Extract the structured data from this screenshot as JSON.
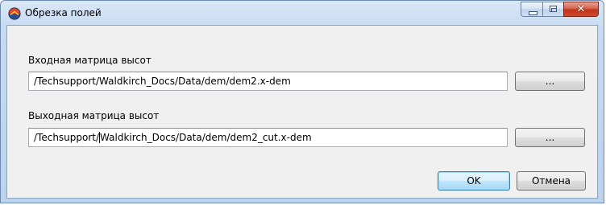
{
  "window": {
    "title": "Обрезка полей",
    "app_icon": "app-logo-icon"
  },
  "caption_buttons": {
    "minimize": "minimize-icon",
    "maximize": "maximize-icon",
    "close": "close-icon",
    "close_glyph": "✕"
  },
  "input_dem": {
    "label": "Входная матрица высот",
    "value": "/Techsupport/Waldkirch_Docs/Data/dem/dem2.x-dem",
    "browse_label": "..."
  },
  "output_dem": {
    "label": "Выходная матрица высот",
    "value_before_caret": "/Techsupport/",
    "value_after_caret": "Waldkirch_Docs/Data/dem/dem2_cut.x-dem",
    "browse_label": "..."
  },
  "footer": {
    "ok_label": "OK",
    "cancel_label": "Отмена"
  },
  "colors": {
    "titlebar": "#c6daf1",
    "client_bg": "#f0f0f0",
    "close_button": "#c0331a",
    "default_button_border": "#3c7fb1"
  }
}
